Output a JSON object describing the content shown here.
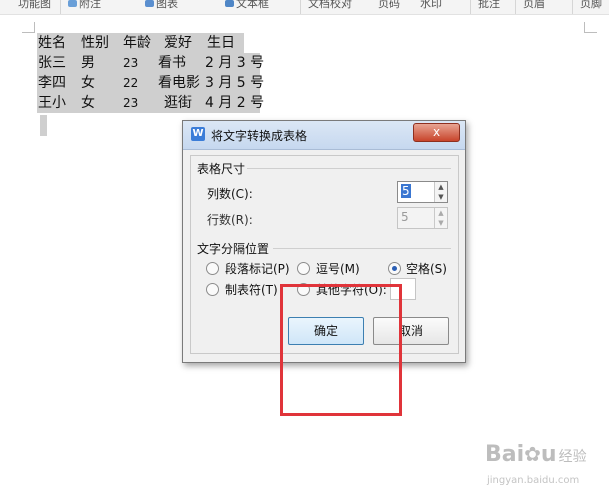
{
  "ribbon": {
    "items": [
      "功能图",
      "附注",
      "图表",
      "文本框",
      "文档校对",
      "页码",
      "水印",
      "批注",
      "页眉",
      "页脚"
    ]
  },
  "document": {
    "rows": [
      [
        "姓名",
        "性别",
        "年龄",
        "爱好",
        "生日"
      ],
      [
        "张三",
        "男",
        "23",
        "看书",
        "2 月 3 号"
      ],
      [
        "李四",
        "女",
        "22",
        "看电影",
        "3 月 5 号"
      ],
      [
        "王小",
        "女",
        "23",
        "逛街",
        "4 月 2 号"
      ]
    ]
  },
  "dialog": {
    "title": "将文字转换成表格",
    "icon_letter": "W",
    "close_label": "x",
    "table_size_group": "表格尺寸",
    "columns_label": "列数(C):",
    "columns_value": "5",
    "rows_label": "行数(R):",
    "rows_value": "5",
    "separator_group": "文字分隔位置",
    "options": [
      {
        "label": "段落标记(P)",
        "checked": false
      },
      {
        "label": "逗号(M)",
        "checked": false
      },
      {
        "label": "空格(S)",
        "checked": true
      },
      {
        "label": "制表符(T)",
        "checked": false
      },
      {
        "label": "其他字符(O):",
        "checked": false
      }
    ],
    "ok_label": "确定",
    "cancel_label": "取消"
  },
  "watermark": {
    "brand": "Bai",
    "brand_suffix": "u",
    "jingyan": "经验",
    "url": "jingyan.baidu.com"
  },
  "colors": {
    "annotation": "#e0343a",
    "selection": "#cfcfcf",
    "default_button_border": "#3c7fb1"
  }
}
